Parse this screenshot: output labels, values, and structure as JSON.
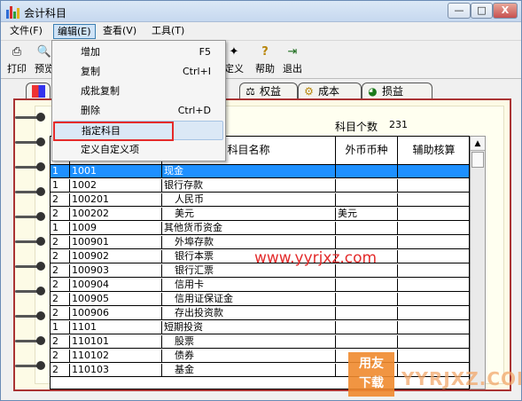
{
  "window": {
    "title": "会计科目",
    "controls": {
      "minimize": "—",
      "maximize": "□",
      "close": "X"
    }
  },
  "menubar": {
    "items": [
      {
        "label": "文件(F)"
      },
      {
        "label": "编辑(E)"
      },
      {
        "label": "查看(V)"
      },
      {
        "label": "工具(T)"
      }
    ]
  },
  "toolbar": {
    "print": {
      "label": "打印",
      "icon": "printer-icon"
    },
    "preview": {
      "label": "预览",
      "icon": "preview-icon"
    },
    "define": {
      "label": "定义",
      "icon": "wand-icon"
    },
    "help": {
      "label": "帮助",
      "icon": "help-icon"
    },
    "exit": {
      "label": "退出",
      "icon": "exit-icon"
    }
  },
  "edit_menu": {
    "items": [
      {
        "label": "增加",
        "shortcut": "F5"
      },
      {
        "label": "复制",
        "shortcut": "Ctrl+I"
      },
      {
        "label": "成批复制",
        "shortcut": ""
      },
      {
        "label": "删除",
        "shortcut": "Ctrl+D"
      },
      {
        "label": "指定科目",
        "shortcut": ""
      },
      {
        "label": "定义自定义项",
        "shortcut": ""
      }
    ],
    "highlighted": "指定科目"
  },
  "tabs": {
    "equity": "权益",
    "cost": "成本",
    "profit_loss": "损益"
  },
  "summary": {
    "count_label": "科目个数",
    "count_value": "231"
  },
  "table": {
    "columns": {
      "name": "科目名称",
      "currency": "外币币种",
      "aux": "辅助核算"
    },
    "rows": [
      {
        "level": "1",
        "code": "1001",
        "name": "现金",
        "currency": "",
        "aux": "",
        "indent": 0
      },
      {
        "level": "1",
        "code": "1002",
        "name": "银行存款",
        "currency": "",
        "aux": "",
        "indent": 0
      },
      {
        "level": "2",
        "code": "100201",
        "name": "人民币",
        "currency": "",
        "aux": "",
        "indent": 1
      },
      {
        "level": "2",
        "code": "100202",
        "name": "美元",
        "currency": "美元",
        "aux": "",
        "indent": 1
      },
      {
        "level": "1",
        "code": "1009",
        "name": "其他货币资金",
        "currency": "",
        "aux": "",
        "indent": 0
      },
      {
        "level": "2",
        "code": "100901",
        "name": "外埠存款",
        "currency": "",
        "aux": "",
        "indent": 1
      },
      {
        "level": "2",
        "code": "100902",
        "name": "银行本票",
        "currency": "",
        "aux": "",
        "indent": 1
      },
      {
        "level": "2",
        "code": "100903",
        "name": "银行汇票",
        "currency": "",
        "aux": "",
        "indent": 1
      },
      {
        "level": "2",
        "code": "100904",
        "name": "信用卡",
        "currency": "",
        "aux": "",
        "indent": 1
      },
      {
        "level": "2",
        "code": "100905",
        "name": "信用证保证金",
        "currency": "",
        "aux": "",
        "indent": 1
      },
      {
        "level": "2",
        "code": "100906",
        "name": "存出投资款",
        "currency": "",
        "aux": "",
        "indent": 1
      },
      {
        "level": "1",
        "code": "1101",
        "name": "短期投资",
        "currency": "",
        "aux": "",
        "indent": 0
      },
      {
        "level": "2",
        "code": "110101",
        "name": "股票",
        "currency": "",
        "aux": "",
        "indent": 1
      },
      {
        "level": "2",
        "code": "110102",
        "name": "债券",
        "currency": "",
        "aux": "",
        "indent": 1
      },
      {
        "level": "2",
        "code": "110103",
        "name": "基金",
        "currency": "",
        "aux": "",
        "indent": 1
      }
    ],
    "selected_index": 0
  },
  "scrollbar": {
    "up": "▲",
    "down": "▼"
  },
  "watermark": {
    "url": "www.yyrjxz.com",
    "logo_line1": "用友",
    "logo_line2": "下载",
    "site": "YYRJXZ.COM"
  },
  "colors": {
    "selection": "#1e90ff",
    "book_border": "#aa3333",
    "watermark": "#e32b2b",
    "highlight_box": "#e52a2a"
  }
}
